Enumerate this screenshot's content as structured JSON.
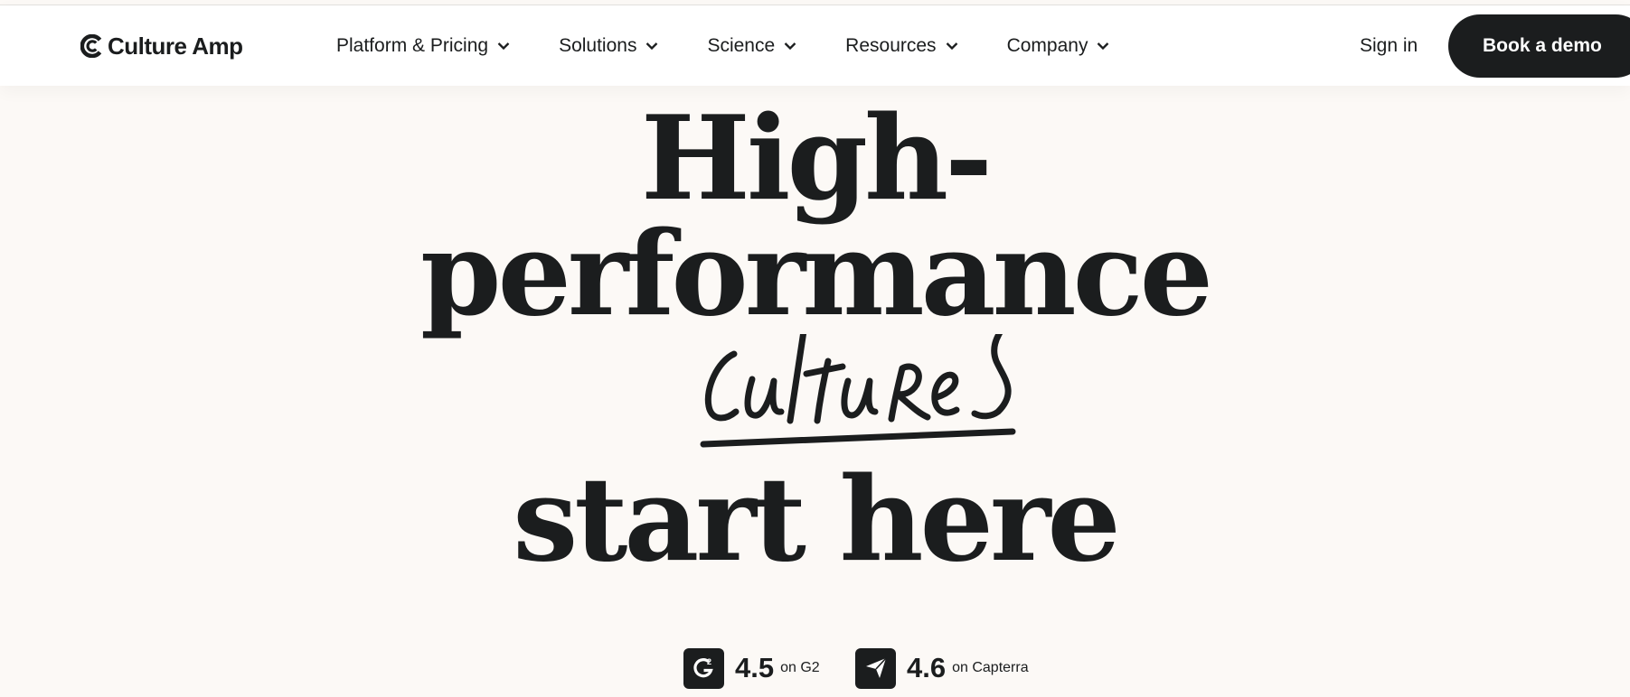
{
  "brand": {
    "name": "Culture Amp",
    "logo_icon": "culture-amp-logo-icon"
  },
  "nav": {
    "items": [
      {
        "label": "Platform & Pricing",
        "icon": "chevron-down-icon"
      },
      {
        "label": "Solutions",
        "icon": "chevron-down-icon"
      },
      {
        "label": "Science",
        "icon": "chevron-down-icon"
      },
      {
        "label": "Resources",
        "icon": "chevron-down-icon"
      },
      {
        "label": "Company",
        "icon": "chevron-down-icon"
      }
    ],
    "signin_label": "Sign in",
    "demo_label": "Book a demo"
  },
  "hero": {
    "line1": "High-",
    "line2": "performance",
    "line3": "cultures",
    "line4": "start here"
  },
  "ratings": [
    {
      "score": "4.5",
      "source": "on G2",
      "icon": "g2-icon"
    },
    {
      "score": "4.6",
      "source": "on Capterra",
      "icon": "capterra-icon"
    }
  ],
  "colors": {
    "background": "#fcf9f6",
    "text": "#1b1d1e",
    "button": "#1b1d1e",
    "nav_background": "#ffffff"
  }
}
